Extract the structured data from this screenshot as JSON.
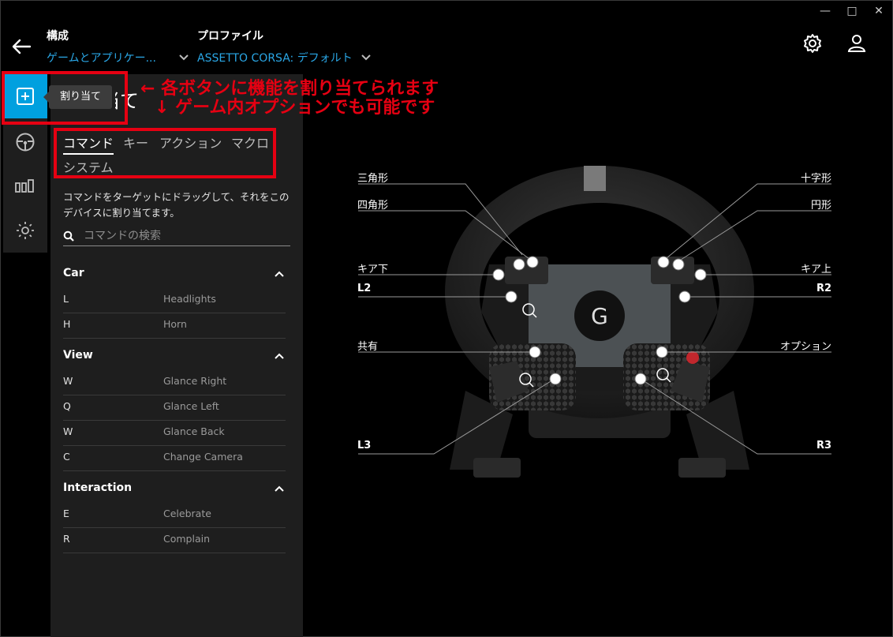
{
  "window": {
    "minimize": "—",
    "maximize": "□",
    "close": "✕"
  },
  "header": {
    "config_label": "構成",
    "config_value": "ゲームとアプリケー...",
    "profile_label": "プロファイル",
    "profile_value": "ASSETTO CORSA: デフォルト"
  },
  "rail": {
    "tooltip": "割り当て",
    "items": [
      "assign",
      "wheel",
      "pedals",
      "settings"
    ]
  },
  "panel": {
    "title": "割り当て",
    "tabs": [
      "コマンド",
      "キー",
      "アクション",
      "マクロ",
      "システム"
    ],
    "active_tab": "コマンド",
    "description": "コマンドをターゲットにドラッグして、それをこのデバイスに割り当てます。",
    "search_placeholder": "コマンドの検索",
    "groups": [
      {
        "title": "Car",
        "rows": [
          {
            "key": "L",
            "action": "Headlights"
          },
          {
            "key": "H",
            "action": "Horn"
          }
        ]
      },
      {
        "title": "View",
        "rows": [
          {
            "key": "W",
            "action": "Glance Right"
          },
          {
            "key": "Q",
            "action": "Glance Left"
          },
          {
            "key": "W",
            "action": "Glance Back"
          },
          {
            "key": "C",
            "action": "Change Camera"
          }
        ]
      },
      {
        "title": "Interaction",
        "rows": [
          {
            "key": "E",
            "action": "Celebrate"
          },
          {
            "key": "R",
            "action": "Complain"
          }
        ]
      }
    ]
  },
  "wheel_labels": {
    "triangle": "三角形",
    "square": "四角形",
    "gear_down": "キア下",
    "l2": "L2",
    "share": "共有",
    "l3": "L3",
    "cross": "十字形",
    "circle": "円形",
    "gear_up": "キア上",
    "r2": "R2",
    "options": "オプション",
    "r3": "R3"
  },
  "annotations": {
    "line1": "←  各ボタンに機能を割り当てられます",
    "line2": "↓ ゲーム内オプションでも可能です"
  },
  "colors": {
    "accent": "#2aa7e6",
    "rail_active": "#00a0df",
    "annotation": "#e60012"
  }
}
